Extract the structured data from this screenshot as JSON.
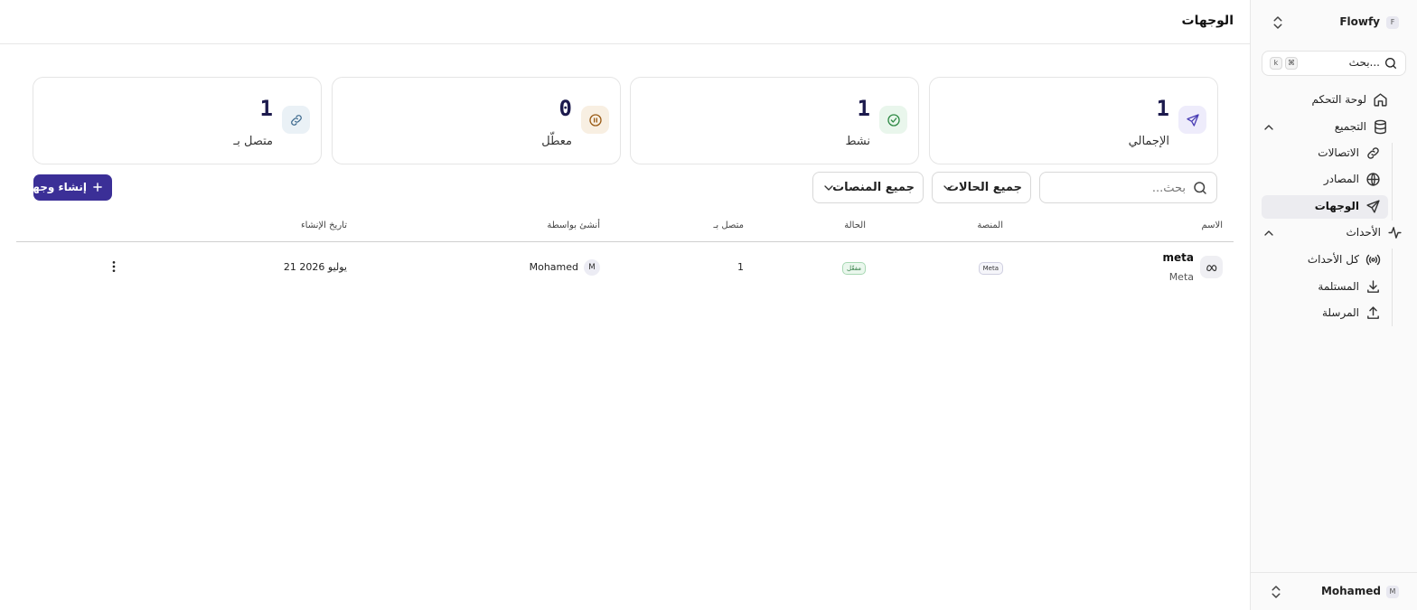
{
  "sidebar": {
    "workspace": {
      "avatar": "F",
      "name": "Flowfy"
    },
    "search": {
      "placeholder": "بحث...",
      "kbd_cmd": "⌘",
      "kbd_key": "k"
    },
    "items": [
      {
        "label": "لوحة التحكم",
        "icon": "home-icon"
      },
      {
        "label": "التجميع",
        "icon": "database-icon"
      },
      {
        "label": "الاتصالات",
        "icon": "link-icon"
      },
      {
        "label": "المصادر",
        "icon": "globe-icon"
      },
      {
        "label": "الوجهات",
        "icon": "send-icon"
      },
      {
        "label": "الأحداث",
        "icon": "activity-icon"
      },
      {
        "label": "كل الأحداث",
        "icon": "radio-icon"
      },
      {
        "label": "المستلمة",
        "icon": "download-icon"
      },
      {
        "label": "المرسلة",
        "icon": "upload-icon"
      }
    ],
    "user": {
      "avatar": "M",
      "name": "Mohamed"
    }
  },
  "header": {
    "title": "الوجهات"
  },
  "stats": [
    {
      "value": "1",
      "label": "الإجمالي",
      "icon": "send-icon",
      "color": "#4b3fb5",
      "bg": "#eeecfb"
    },
    {
      "value": "1",
      "label": "نشط",
      "icon": "check-circle-icon",
      "color": "#2f8a45",
      "bg": "#e9f6ec"
    },
    {
      "value": "0",
      "label": "معطّل",
      "icon": "pause-circle-icon",
      "color": "#9a5b15",
      "bg": "#f8efe2"
    },
    {
      "value": "1",
      "label": "متصل بـ",
      "icon": "link-icon",
      "color": "#3f6b8f",
      "bg": "#eaf1f6"
    }
  ],
  "filters": {
    "search_placeholder": "بحث...",
    "status_select": "جميع الحالات",
    "platform_select": "جميع المنصات",
    "create_button": "إنشاء وجهة"
  },
  "table": {
    "columns": {
      "name": "الاسم",
      "platform": "المنصة",
      "status": "الحالة",
      "connected": "متصل بـ",
      "created_by": "أنشئ بواسطة",
      "created_at": "تاريخ الإنشاء"
    },
    "rows": [
      {
        "name": "meta",
        "sub": "Meta",
        "icon": "meta-icon",
        "platform": "Meta",
        "status": "مفعّل",
        "connected": "1",
        "creator_avatar": "M",
        "creator": "Mohamed",
        "created_at": "21 يوليو 2026"
      }
    ]
  }
}
